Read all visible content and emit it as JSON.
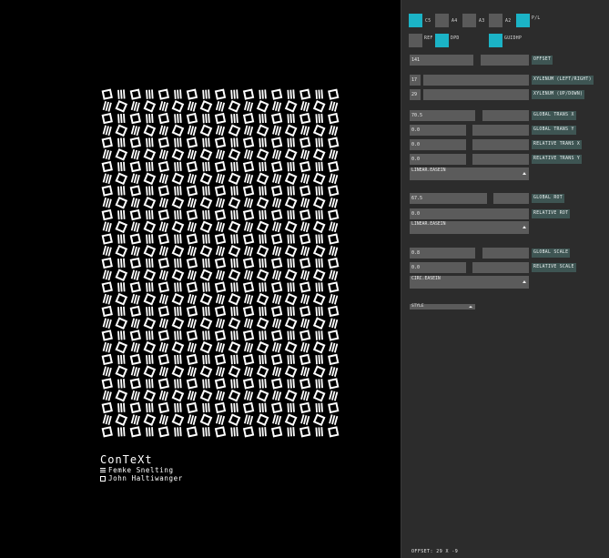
{
  "poster": {
    "title": "ConTeXt",
    "authors": [
      "Femke Snelting",
      "John Haltiwanger"
    ]
  },
  "toggles": {
    "c5": {
      "label": "C5",
      "on": true
    },
    "a4": {
      "label": "A4",
      "on": false
    },
    "a3": {
      "label": "A3",
      "on": false
    },
    "a2": {
      "label": "A2",
      "on": false
    },
    "pl": {
      "label": "P/L",
      "on": true
    },
    "ref": {
      "label": "REF",
      "on": false
    },
    "dpd": {
      "label": "DPD",
      "on": true
    },
    "guide": {
      "label": "GUIDHP",
      "on": true
    }
  },
  "controls": {
    "offset": {
      "value": "141",
      "label": "OFFSET"
    },
    "xylenum_lr": {
      "value": "17",
      "label": "XYLENUM  (LEFT/RIGHT)"
    },
    "xylenum_ud": {
      "value": "29",
      "label": "XYLENUM  (UP/DOWN)"
    },
    "global_trans_x": {
      "value": "70.5",
      "label": "GLOBAL TRANS X"
    },
    "global_trans_y": {
      "value": "0.0",
      "label": "GLOBAL TRANS Y"
    },
    "relative_trans_x": {
      "value": "0.0",
      "label": "RELATIVE TRANS X"
    },
    "relative_trans_y": {
      "value": "0.0",
      "label": "RELATIVE TRANS Y"
    },
    "trans_easing": "LINEAR.EASEIN",
    "global_rot": {
      "value": "67.5",
      "label": "GLOBAL ROT"
    },
    "relative_rot": {
      "value": "0.0",
      "label": "RELATIVE ROT"
    },
    "rot_easing": "LINEAR.EASEIN",
    "global_scale": {
      "value": "0.8",
      "label": "GLOBAL SCALE"
    },
    "relative_scale": {
      "value": "0.0",
      "label": "RELATIVE SCALE"
    },
    "scale_easing": "CIRC.EASEIN",
    "style": "STYLE"
  },
  "status": "OFFSET: 29 X -9",
  "colors": {
    "accent": "#1bb3c6",
    "panel": "#2c2c2c",
    "field": "#5b5b5b",
    "label_button": "#3e5553"
  },
  "icons": {
    "dropdown": "triangle-up-icon",
    "author_1": "striped-square-glyph",
    "author_2": "hollow-square-glyph"
  }
}
